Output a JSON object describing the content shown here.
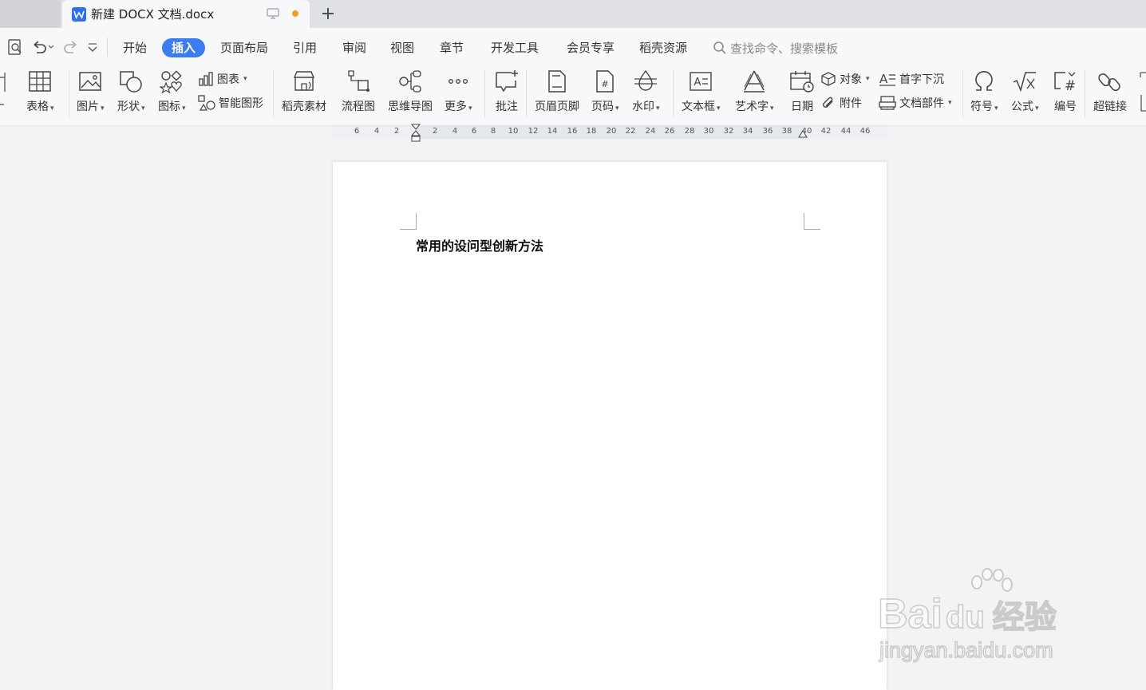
{
  "tabbar": {
    "document_title": "新建 DOCX 文档.docx",
    "status_dot_color": "#f0a020"
  },
  "menu": {
    "items": [
      "开始",
      "插入",
      "页面布局",
      "引用",
      "审阅",
      "视图",
      "章节",
      "开发工具",
      "会员专享",
      "稻壳资源"
    ],
    "active": "插入",
    "search_placeholder": "查找命令、搜索模板"
  },
  "ribbon": {
    "table": "表格",
    "picture": "图片",
    "shape": "形状",
    "icon": "图标",
    "chart": "图表",
    "smart_art": "智能图形",
    "docer_material": "稻壳素材",
    "flowchart": "流程图",
    "mindmap": "思维导图",
    "more": "更多",
    "comment": "批注",
    "header_footer": "页眉页脚",
    "page_number": "页码",
    "watermark": "水印",
    "textbox": "文本框",
    "wordart": "艺术字",
    "date": "日期",
    "object": "对象",
    "attachment": "附件",
    "drop_cap": "首字下沉",
    "doc_parts": "文档部件",
    "symbol": "符号",
    "formula": "公式",
    "numbering": "编号",
    "hyperlink": "超链接"
  },
  "ruler": {
    "ticks": [
      "6",
      "4",
      "2",
      "2",
      "4",
      "6",
      "8",
      "10",
      "12",
      "14",
      "16",
      "18",
      "20",
      "22",
      "24",
      "26",
      "28",
      "30",
      "32",
      "34",
      "36",
      "38",
      "40",
      "42",
      "44",
      "46"
    ]
  },
  "document": {
    "text": "常用的设问型创新方法"
  },
  "watermark": {
    "brand": "Bai",
    "brand2": "du",
    "cn": "经验",
    "url": "jingyan.baidu.com"
  },
  "accent_color": "#3b7cf0"
}
